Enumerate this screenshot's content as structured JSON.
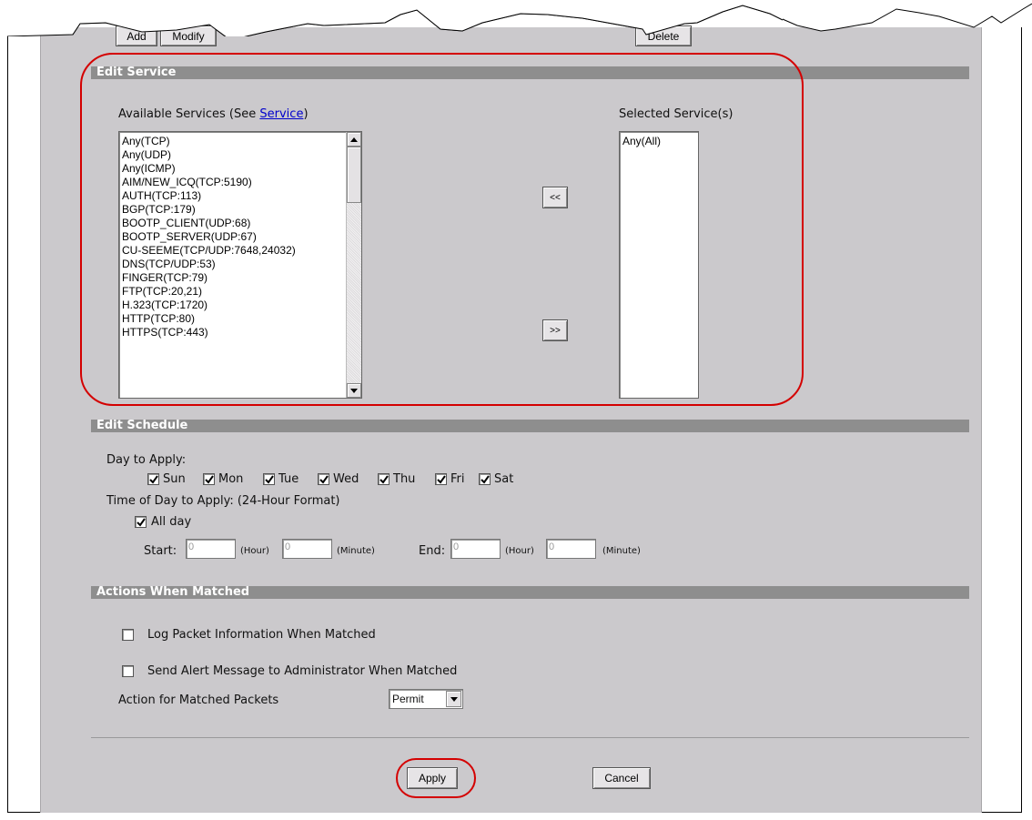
{
  "top_buttons": {
    "add": "Add",
    "modify": "Modify",
    "delete": "Delete"
  },
  "edit_service": {
    "title": "Edit Service",
    "available_label_prefix": "Available Services  (See ",
    "available_link": "Service",
    "available_label_suffix": ")",
    "selected_label": "Selected Service(s)",
    "available_services": [
      "Any(TCP)",
      "Any(UDP)",
      "Any(ICMP)",
      "AIM/NEW_ICQ(TCP:5190)",
      "AUTH(TCP:113)",
      "BGP(TCP:179)",
      "BOOTP_CLIENT(UDP:68)",
      "BOOTP_SERVER(UDP:67)",
      "CU-SEEME(TCP/UDP:7648,24032)",
      "DNS(TCP/UDP:53)",
      "FINGER(TCP:79)",
      "FTP(TCP:20,21)",
      "H.323(TCP:1720)",
      "HTTP(TCP:80)",
      "HTTPS(TCP:443)"
    ],
    "selected_services": [
      "Any(All)"
    ],
    "add_arrow": "<<",
    "remove_arrow": ">>"
  },
  "edit_schedule": {
    "title": "Edit Schedule",
    "day_label": "Day to Apply:",
    "days": [
      {
        "name": "Sun",
        "checked": true
      },
      {
        "name": "Mon",
        "checked": true
      },
      {
        "name": "Tue",
        "checked": true
      },
      {
        "name": "Wed",
        "checked": true
      },
      {
        "name": "Thu",
        "checked": true
      },
      {
        "name": "Fri",
        "checked": true
      },
      {
        "name": "Sat",
        "checked": true
      }
    ],
    "time_label": "Time of Day to Apply: (24-Hour Format)",
    "all_day_label": "All day",
    "all_day_checked": true,
    "start_label": "Start:",
    "end_label": "End:",
    "hour_label": "(Hour)",
    "minute_label": "(Minute)",
    "start_hour": "0",
    "start_minute": "0",
    "end_hour": "0",
    "end_minute": "0"
  },
  "actions": {
    "title": "Actions When Matched",
    "log_label": "Log Packet Information When Matched",
    "log_checked": false,
    "alert_label": "Send Alert Message to Administrator When Matched",
    "alert_checked": false,
    "action_label": "Action for Matched Packets",
    "action_value": "Permit"
  },
  "footer": {
    "apply": "Apply",
    "cancel": "Cancel"
  },
  "colors": {
    "section_bar": "#8e8e8e",
    "panel": "#cbc9cc",
    "callout": "#d40000",
    "link": "#0000cc"
  }
}
